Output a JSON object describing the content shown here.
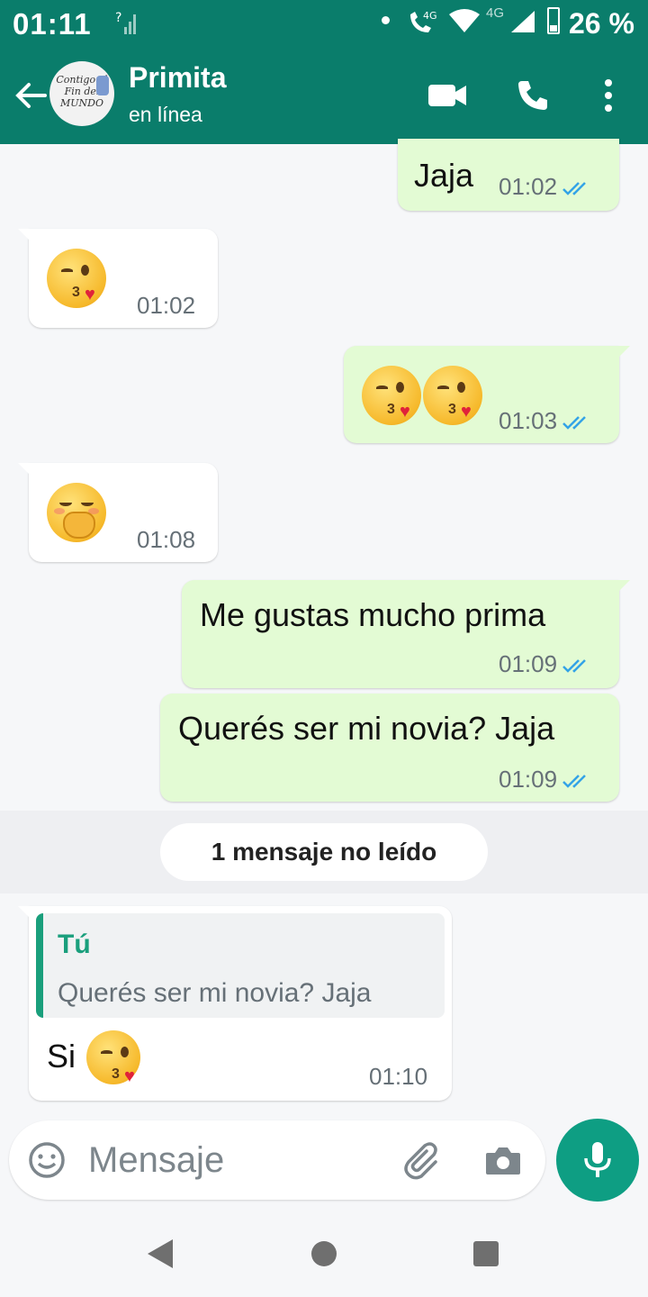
{
  "status_bar": {
    "time": "01:11",
    "network_label": "4G",
    "secondary_network_label": "4G",
    "battery": "26 %"
  },
  "header": {
    "contact_name": "Primita",
    "contact_status": "en línea",
    "avatar_text": "Contigo al Fin del MUNDO"
  },
  "messages": [
    {
      "direction": "out",
      "text": "Jaja",
      "time": "01:02",
      "status": "read"
    },
    {
      "direction": "in",
      "emoji": "kissing-heart",
      "time": "01:02"
    },
    {
      "direction": "out",
      "emoji": "kissing-heart x2",
      "time": "01:03",
      "status": "read"
    },
    {
      "direction": "in",
      "emoji": "hand-over-mouth",
      "time": "01:08"
    },
    {
      "direction": "out",
      "text": "Me gustas mucho prima",
      "time": "01:09",
      "status": "read"
    },
    {
      "direction": "out",
      "text": "Querés ser mi novia? Jaja",
      "time": "01:09",
      "status": "read"
    },
    {
      "direction": "in",
      "quote_author": "Tú",
      "quote_text": "Querés ser mi novia? Jaja",
      "text": "Si",
      "emoji": "kissing-heart",
      "time": "01:10"
    }
  ],
  "unread_label": "1 mensaje no leído",
  "composer": {
    "placeholder": "Mensaje"
  },
  "colors": {
    "header": "#0a7d6b",
    "outgoing": "#e3fbd4",
    "incoming": "#ffffff",
    "accent": "#0e9e83",
    "read_ticks": "#34a3e6"
  }
}
